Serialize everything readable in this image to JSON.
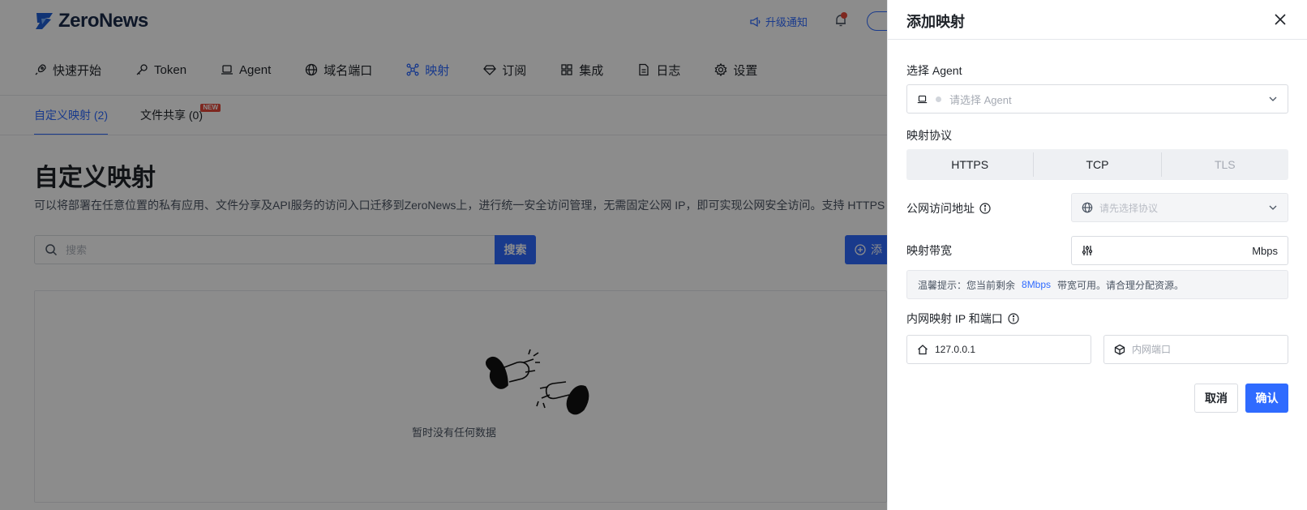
{
  "app": {
    "name": "ZeroNews"
  },
  "header": {
    "upgrade_label": "升级通知"
  },
  "nav": [
    {
      "label": "快速开始",
      "icon": "rocket-icon"
    },
    {
      "label": "Token",
      "icon": "key-icon"
    },
    {
      "label": "Agent",
      "icon": "laptop-icon"
    },
    {
      "label": "域名端口",
      "icon": "globe-icon"
    },
    {
      "label": "映射",
      "icon": "mapping-icon",
      "active": true
    },
    {
      "label": "订阅",
      "icon": "diamond-icon"
    },
    {
      "label": "集成",
      "icon": "grid-icon"
    },
    {
      "label": "日志",
      "icon": "document-icon"
    },
    {
      "label": "设置",
      "icon": "gear-icon"
    }
  ],
  "subtabs": [
    {
      "label": "自定义映射 (2)",
      "active": true
    },
    {
      "label": "文件共享 (0)",
      "badge": "NEW"
    }
  ],
  "page": {
    "title": "自定义映射",
    "description": "可以将部署在任意位置的私有应用、文件分享及API服务的访问入口迁移到ZeroNews上，进行统一安全访问管理，无需固定公网 IP，即可实现公网安全访问。支持 HTTPS",
    "search_placeholder": "搜索",
    "search_button": "搜索",
    "add_button": "添",
    "empty_text": "暂时没有任何数据"
  },
  "drawer": {
    "title": "添加映射",
    "agent_label": "选择 Agent",
    "agent_placeholder": "请选择 Agent",
    "protocol_label": "映射协议",
    "protocols": [
      {
        "label": "HTTPS",
        "disabled": false
      },
      {
        "label": "TCP",
        "disabled": false
      },
      {
        "label": "TLS",
        "disabled": true
      }
    ],
    "public_label": "公网访问地址",
    "public_placeholder": "请先选择协议",
    "bandwidth_label": "映射带宽",
    "bandwidth_value": "",
    "bandwidth_unit": "Mbps",
    "tip_prefix": "温馨提示：您当前剩余",
    "tip_value": "8Mbps",
    "tip_suffix": "带宽可用。请合理分配资源。",
    "internal_label": "内网映射 IP 和端口",
    "ip_value": "127.0.0.1",
    "port_placeholder": "内网端口",
    "cancel_label": "取消",
    "confirm_label": "确认"
  },
  "colors": {
    "accent": "#2f6bff",
    "alert": "#e5483a"
  }
}
